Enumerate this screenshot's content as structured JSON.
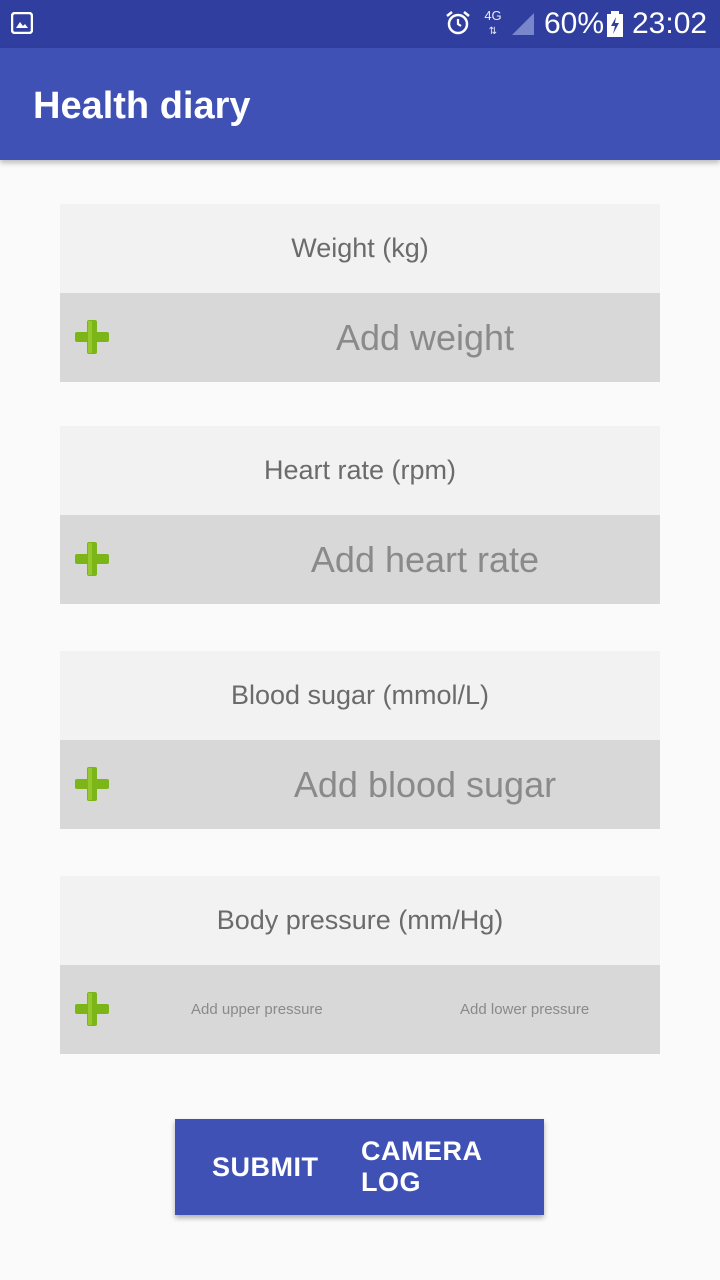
{
  "status_bar": {
    "network": "4G",
    "battery_percent": "60%",
    "time": "23:02"
  },
  "app_bar": {
    "title": "Health diary"
  },
  "cards": [
    {
      "header": "Weight (kg)",
      "input_placeholder": "Add weight"
    },
    {
      "header": "Heart rate (rpm)",
      "input_placeholder": "Add heart rate"
    },
    {
      "header": "Blood sugar (mmol/L)",
      "input_placeholder": "Add blood sugar"
    },
    {
      "header": "Body pressure (mm/Hg)",
      "upper_placeholder": "Add upper pressure",
      "lower_placeholder": "Add lower pressure"
    }
  ],
  "buttons": {
    "submit": "SUBMIT",
    "camera_log": "CAMERA LOG"
  },
  "colors": {
    "status_bar": "#303f9f",
    "app_bar": "#3f51b5",
    "plus_icon": "#7cb518"
  }
}
